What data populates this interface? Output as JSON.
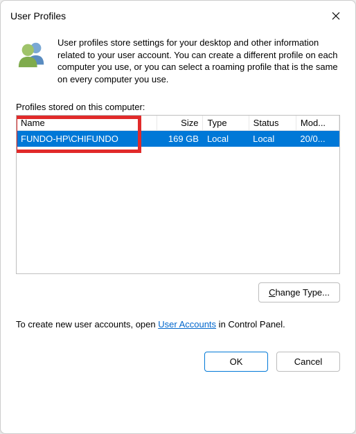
{
  "titlebar": {
    "title": "User Profiles"
  },
  "intro": {
    "text": "User profiles store settings for your desktop and other information related to your user account. You can create a different profile on each computer you use, or you can select a roaming profile that is the same on every computer you use."
  },
  "list_label": "Profiles stored on this computer:",
  "table": {
    "headers": {
      "name": "Name",
      "size": "Size",
      "type": "Type",
      "status": "Status",
      "modified": "Mod..."
    },
    "rows": [
      {
        "name": "FUNDO-HP\\CHIFUNDO",
        "size": "169 GB",
        "type": "Local",
        "status": "Local",
        "modified": "20/0..."
      }
    ]
  },
  "buttons": {
    "change_type_rest": "hange Type...",
    "ok": "OK",
    "cancel": "Cancel"
  },
  "bottom_text": {
    "prefix": "To create new user accounts, open ",
    "link": "User Accounts",
    "suffix": " in Control Panel."
  }
}
